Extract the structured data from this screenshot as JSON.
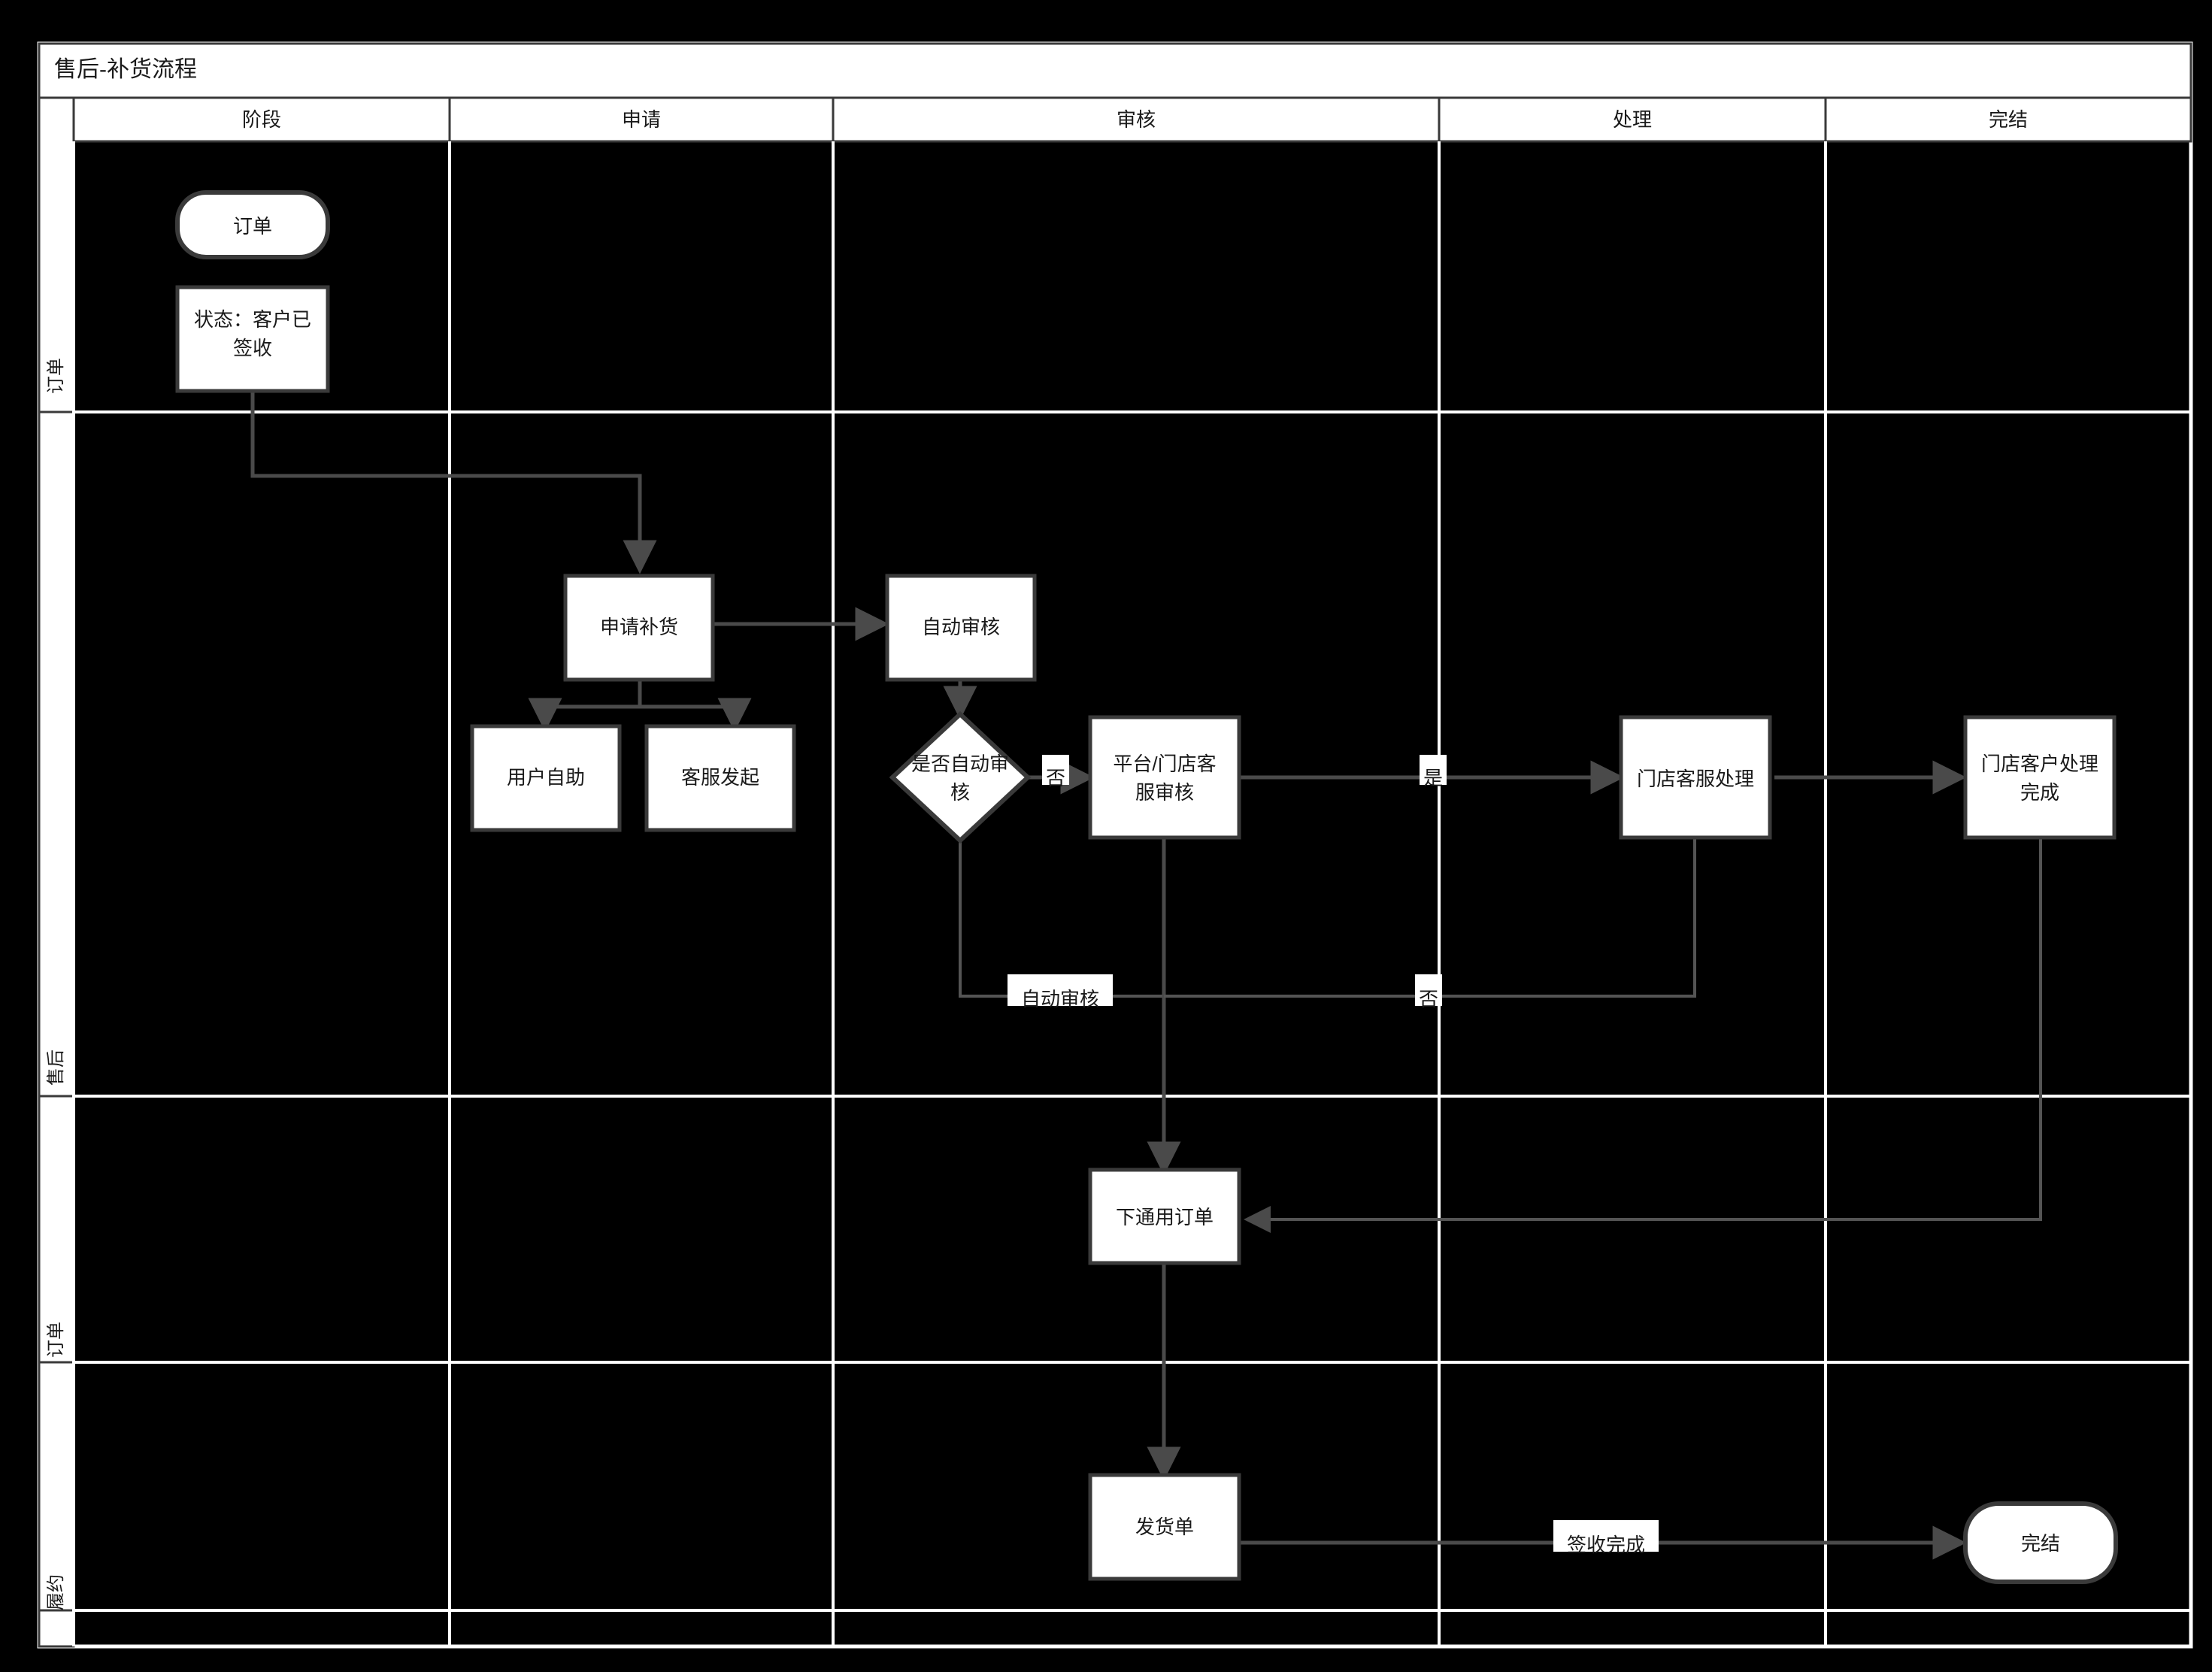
{
  "diagram": {
    "title": "售后-补货流程",
    "columns": [
      {
        "label": "阶段"
      },
      {
        "label": "申请"
      },
      {
        "label": "审核"
      },
      {
        "label": "处理"
      },
      {
        "label": "完结"
      }
    ],
    "lanes": [
      {
        "label": "订单"
      },
      {
        "label": "售后"
      },
      {
        "label": "订单"
      },
      {
        "label": "履约"
      }
    ],
    "nodes": [
      {
        "id": "order-start",
        "label": "订单",
        "shape": "rounded"
      },
      {
        "id": "order-status",
        "label": "状态：客户已\n签收",
        "shape": "rect",
        "line1": "状态：客户已",
        "line2": "签收"
      },
      {
        "id": "apply-restock",
        "label": "申请补货",
        "shape": "rect"
      },
      {
        "id": "user-self",
        "label": "用户自助",
        "shape": "rect"
      },
      {
        "id": "service-initiate",
        "label": "客服发起",
        "shape": "rect"
      },
      {
        "id": "auto-review",
        "label": "自动审核",
        "shape": "rect"
      },
      {
        "id": "is-auto-review",
        "label": "是否自动审\n核",
        "shape": "diamond",
        "line1": "是否自动审",
        "line2": "核"
      },
      {
        "id": "platform-store-review",
        "label": "平台/门店客\n服审核",
        "shape": "rect",
        "line1": "平台/门店客",
        "line2": "服审核"
      },
      {
        "id": "store-service-handle",
        "label": "门店客服处理",
        "shape": "rect"
      },
      {
        "id": "store-customer-done",
        "label": "门店客户处理\n完成",
        "shape": "rect",
        "line1": "门店客户处理",
        "line2": "完成"
      },
      {
        "id": "place-general-order",
        "label": "下通用订单",
        "shape": "rect"
      },
      {
        "id": "shipment-order",
        "label": "发货单",
        "shape": "rect"
      },
      {
        "id": "finish",
        "label": "完结",
        "shape": "rounded"
      }
    ],
    "edge_labels": [
      {
        "id": "no-1",
        "label": "否"
      },
      {
        "id": "yes-1",
        "label": "是"
      },
      {
        "id": "auto-review-label",
        "label": "自动审核"
      },
      {
        "id": "no-2",
        "label": "否"
      },
      {
        "id": "sign-complete",
        "label": "签收完成"
      }
    ],
    "colors": {
      "background": "#000000",
      "node_fill": "#ffffff",
      "node_stroke": "#3a3a3a",
      "edge": "#4a4a4a",
      "frame": "#ffffff",
      "text": "#1a1a1a"
    }
  }
}
